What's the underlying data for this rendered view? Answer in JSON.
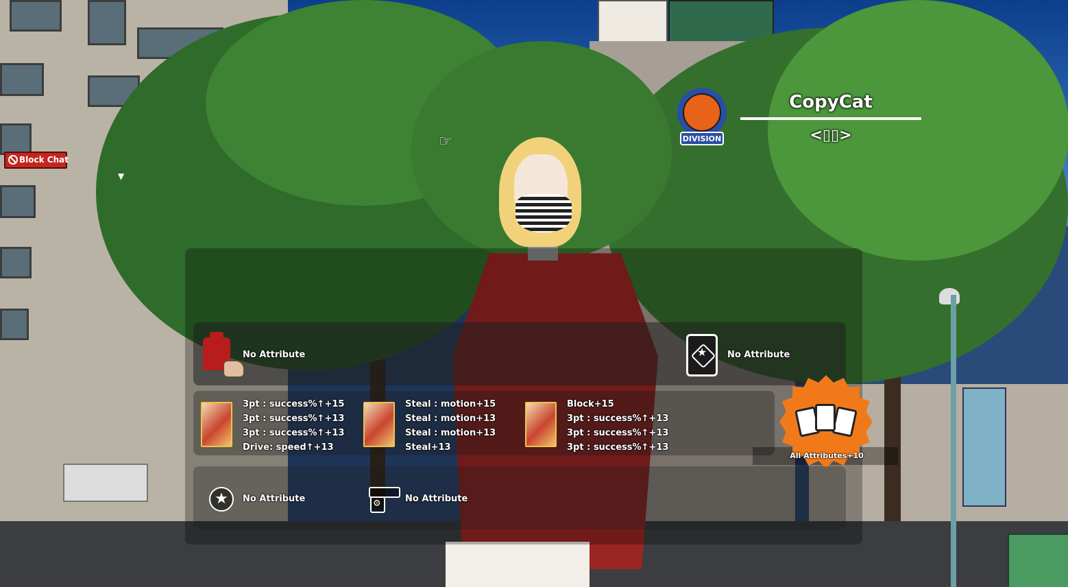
{
  "block_chat_label": "Block Chat",
  "player": {
    "name": "CopyCat",
    "tag": "<▯▯>",
    "division_label": "DIVISION"
  },
  "slots": {
    "costume": {
      "icon": "outfit-icon",
      "attribute": "No Attribute"
    },
    "card_slot": {
      "icon": "card-slot-icon",
      "attribute": "No Attribute"
    },
    "star_slot": {
      "icon": "star-icon",
      "attribute": "No Attribute"
    },
    "accessory_slot": {
      "icon": "gun-icon",
      "attribute": "No Attribute"
    }
  },
  "cards": [
    {
      "stats": [
        "3pt : success%↑+15",
        "3pt : success%↑+13",
        "3pt : success%↑+13",
        "Drive: speed↑+13"
      ]
    },
    {
      "stats": [
        "Steal : motion+15",
        "Steal : motion+13",
        "Steal : motion+13",
        "Steal+13"
      ]
    },
    {
      "stats": [
        "Block+15",
        "3pt : success%↑+13",
        "3pt : success%↑+13",
        "3pt : success%↑+13"
      ]
    }
  ],
  "set_bonus": {
    "label": "All Attributes+10",
    "icon": "cards-badge-icon",
    "color": "#f07a1a"
  }
}
